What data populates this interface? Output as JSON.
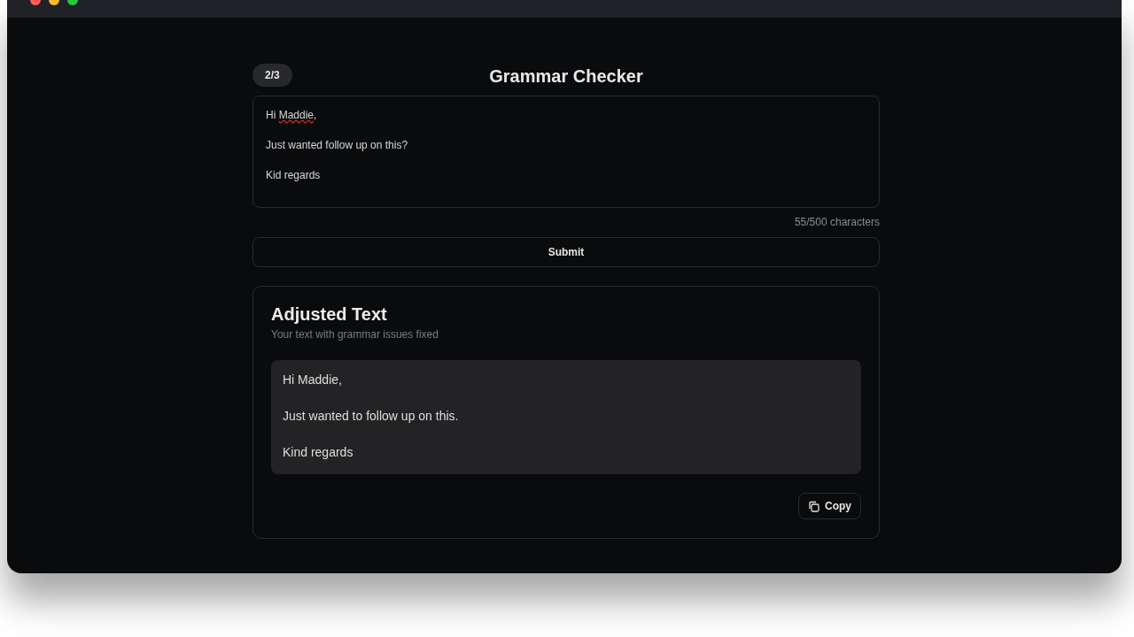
{
  "page": {
    "title": "Grammar Checker",
    "step": "2/3"
  },
  "input": {
    "lines": [
      {
        "segments": [
          {
            "text": "Hi ",
            "misspelled": false
          },
          {
            "text": "Maddie",
            "misspelled": true
          },
          {
            "text": ",",
            "misspelled": false
          }
        ]
      },
      {
        "segments": [
          {
            "text": "Just wanted follow up on this?",
            "misspelled": false
          }
        ]
      },
      {
        "segments": [
          {
            "text": "Kid regards",
            "misspelled": false
          }
        ]
      }
    ],
    "counter": "55/500 characters"
  },
  "submit_button": "Submit",
  "result": {
    "title": "Adjusted Text",
    "subtitle": "Your text with grammar issues fixed",
    "lines": [
      "Hi Maddie,",
      "Just wanted to follow up on this.",
      "Kind regards"
    ],
    "copy_button": "Copy"
  }
}
